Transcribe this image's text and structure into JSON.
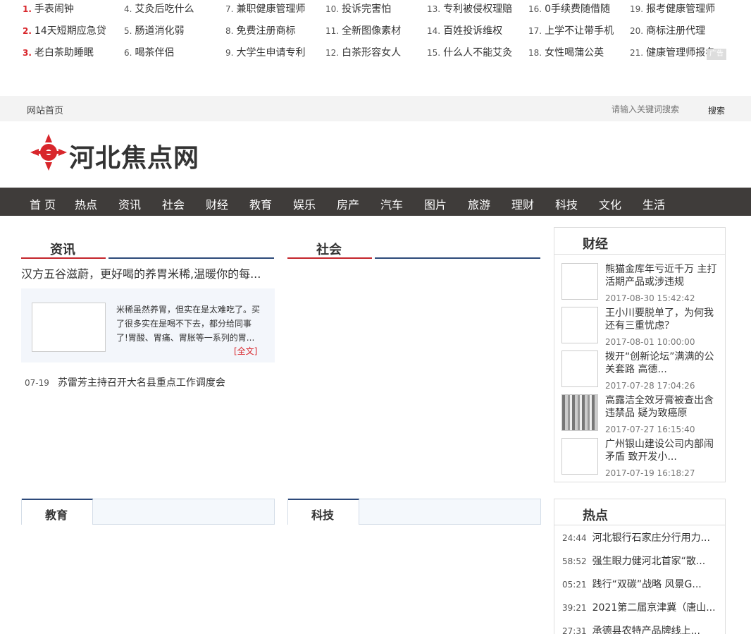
{
  "hot_search": [
    {
      "num": "1.",
      "text": "手表闹钟",
      "red": true
    },
    {
      "num": "2.",
      "text": "14天短期应急贷",
      "red": true
    },
    {
      "num": "3.",
      "text": "老白茶助睡眠",
      "red": true
    },
    {
      "num": "4.",
      "text": "艾灸后吃什么",
      "red": false
    },
    {
      "num": "5.",
      "text": "肠道消化弱",
      "red": false
    },
    {
      "num": "6.",
      "text": "喝茶伴侣",
      "red": false
    },
    {
      "num": "7.",
      "text": "兼职健康管理师",
      "red": false
    },
    {
      "num": "8.",
      "text": "免费注册商标",
      "red": false
    },
    {
      "num": "9.",
      "text": "大学生申请专利",
      "red": false
    },
    {
      "num": "10.",
      "text": "投诉完害怕",
      "red": false
    },
    {
      "num": "11.",
      "text": "全新图像素材",
      "red": false
    },
    {
      "num": "12.",
      "text": "白茶形容女人",
      "red": false
    },
    {
      "num": "13.",
      "text": "专利被侵权理赔",
      "red": false
    },
    {
      "num": "14.",
      "text": "百姓投诉维权",
      "red": false
    },
    {
      "num": "15.",
      "text": "什么人不能艾灸",
      "red": false
    },
    {
      "num": "16.",
      "text": "0手续费随借随",
      "red": false
    },
    {
      "num": "17.",
      "text": "上学不让带手机",
      "red": false
    },
    {
      "num": "18.",
      "text": "女性喝蒲公英",
      "red": false
    },
    {
      "num": "19.",
      "text": "报考健康管理师",
      "red": false
    },
    {
      "num": "20.",
      "text": "商标注册代理",
      "red": false
    },
    {
      "num": "21.",
      "text": "健康管理师报名",
      "red": false
    }
  ],
  "ad_label": "广告",
  "topbar": {
    "home_link": "网站首页",
    "search_placeholder": "请输入关键词搜索",
    "search_button": "搜索"
  },
  "logo_text": "河北焦点网",
  "nav": [
    "首 页",
    "热点",
    "资讯",
    "社会",
    "财经",
    "教育",
    "娱乐",
    "房产",
    "汽车",
    "图片",
    "旅游",
    "理财",
    "科技",
    "文化",
    "生活"
  ],
  "sections": {
    "news": "资讯",
    "society": "社会",
    "finance": "财经",
    "education": "教育",
    "tech": "科技",
    "hot": "热点"
  },
  "lead": {
    "title": "汉方五谷滋蔚，更好喝的养胃米稀,温暖你的每...",
    "desc": "米稀虽然养胃，但实在是太难吃了。买了很多实在是喝不下去，都分给同事了!胃酸、胃痛、胃胀等一系列的胃...",
    "more": "[全文]"
  },
  "news_list": [
    {
      "date": "07-19",
      "title": "苏雷芳主持召开大名县重点工作调度会"
    }
  ],
  "finance_list": [
    {
      "title": "熊猫金库年亏近千万 主打活期产品或涉违规",
      "time": "2017-08-30 15:42:42",
      "photo": false
    },
    {
      "title": "王小川要脱单了，为何我还有三重忧虑？",
      "time": "2017-08-01 10:00:00",
      "photo": false
    },
    {
      "title": "拨开“创新论坛”满满的公关套路 高德...",
      "time": "2017-07-28 17:04:26",
      "photo": false
    },
    {
      "title": "高露洁全效牙膏被查出含违禁品 疑为致癌原",
      "time": "2017-07-27 16:15:40",
      "photo": true
    },
    {
      "title": "广州银山建设公司内部闹矛盾 致开发小...",
      "time": "2017-07-19 16:18:27",
      "photo": false
    }
  ],
  "hot_list": [
    {
      "time": "24:44",
      "title": "河北银行石家庄分行用力..."
    },
    {
      "time": "58:52",
      "title": "强生眼力健河北首家“散..."
    },
    {
      "time": "05:21",
      "title": "践行“双碳”战略 风景G..."
    },
    {
      "time": "39:21",
      "title": "2021第二届京津冀（唐山..."
    },
    {
      "time": "27:31",
      "title": "承德县农特产品牌线上..."
    }
  ],
  "colors": {
    "brand_red": "#c4262c",
    "nav_bg": "#3f3c3a",
    "accent_blue": "#2d4a7a"
  }
}
